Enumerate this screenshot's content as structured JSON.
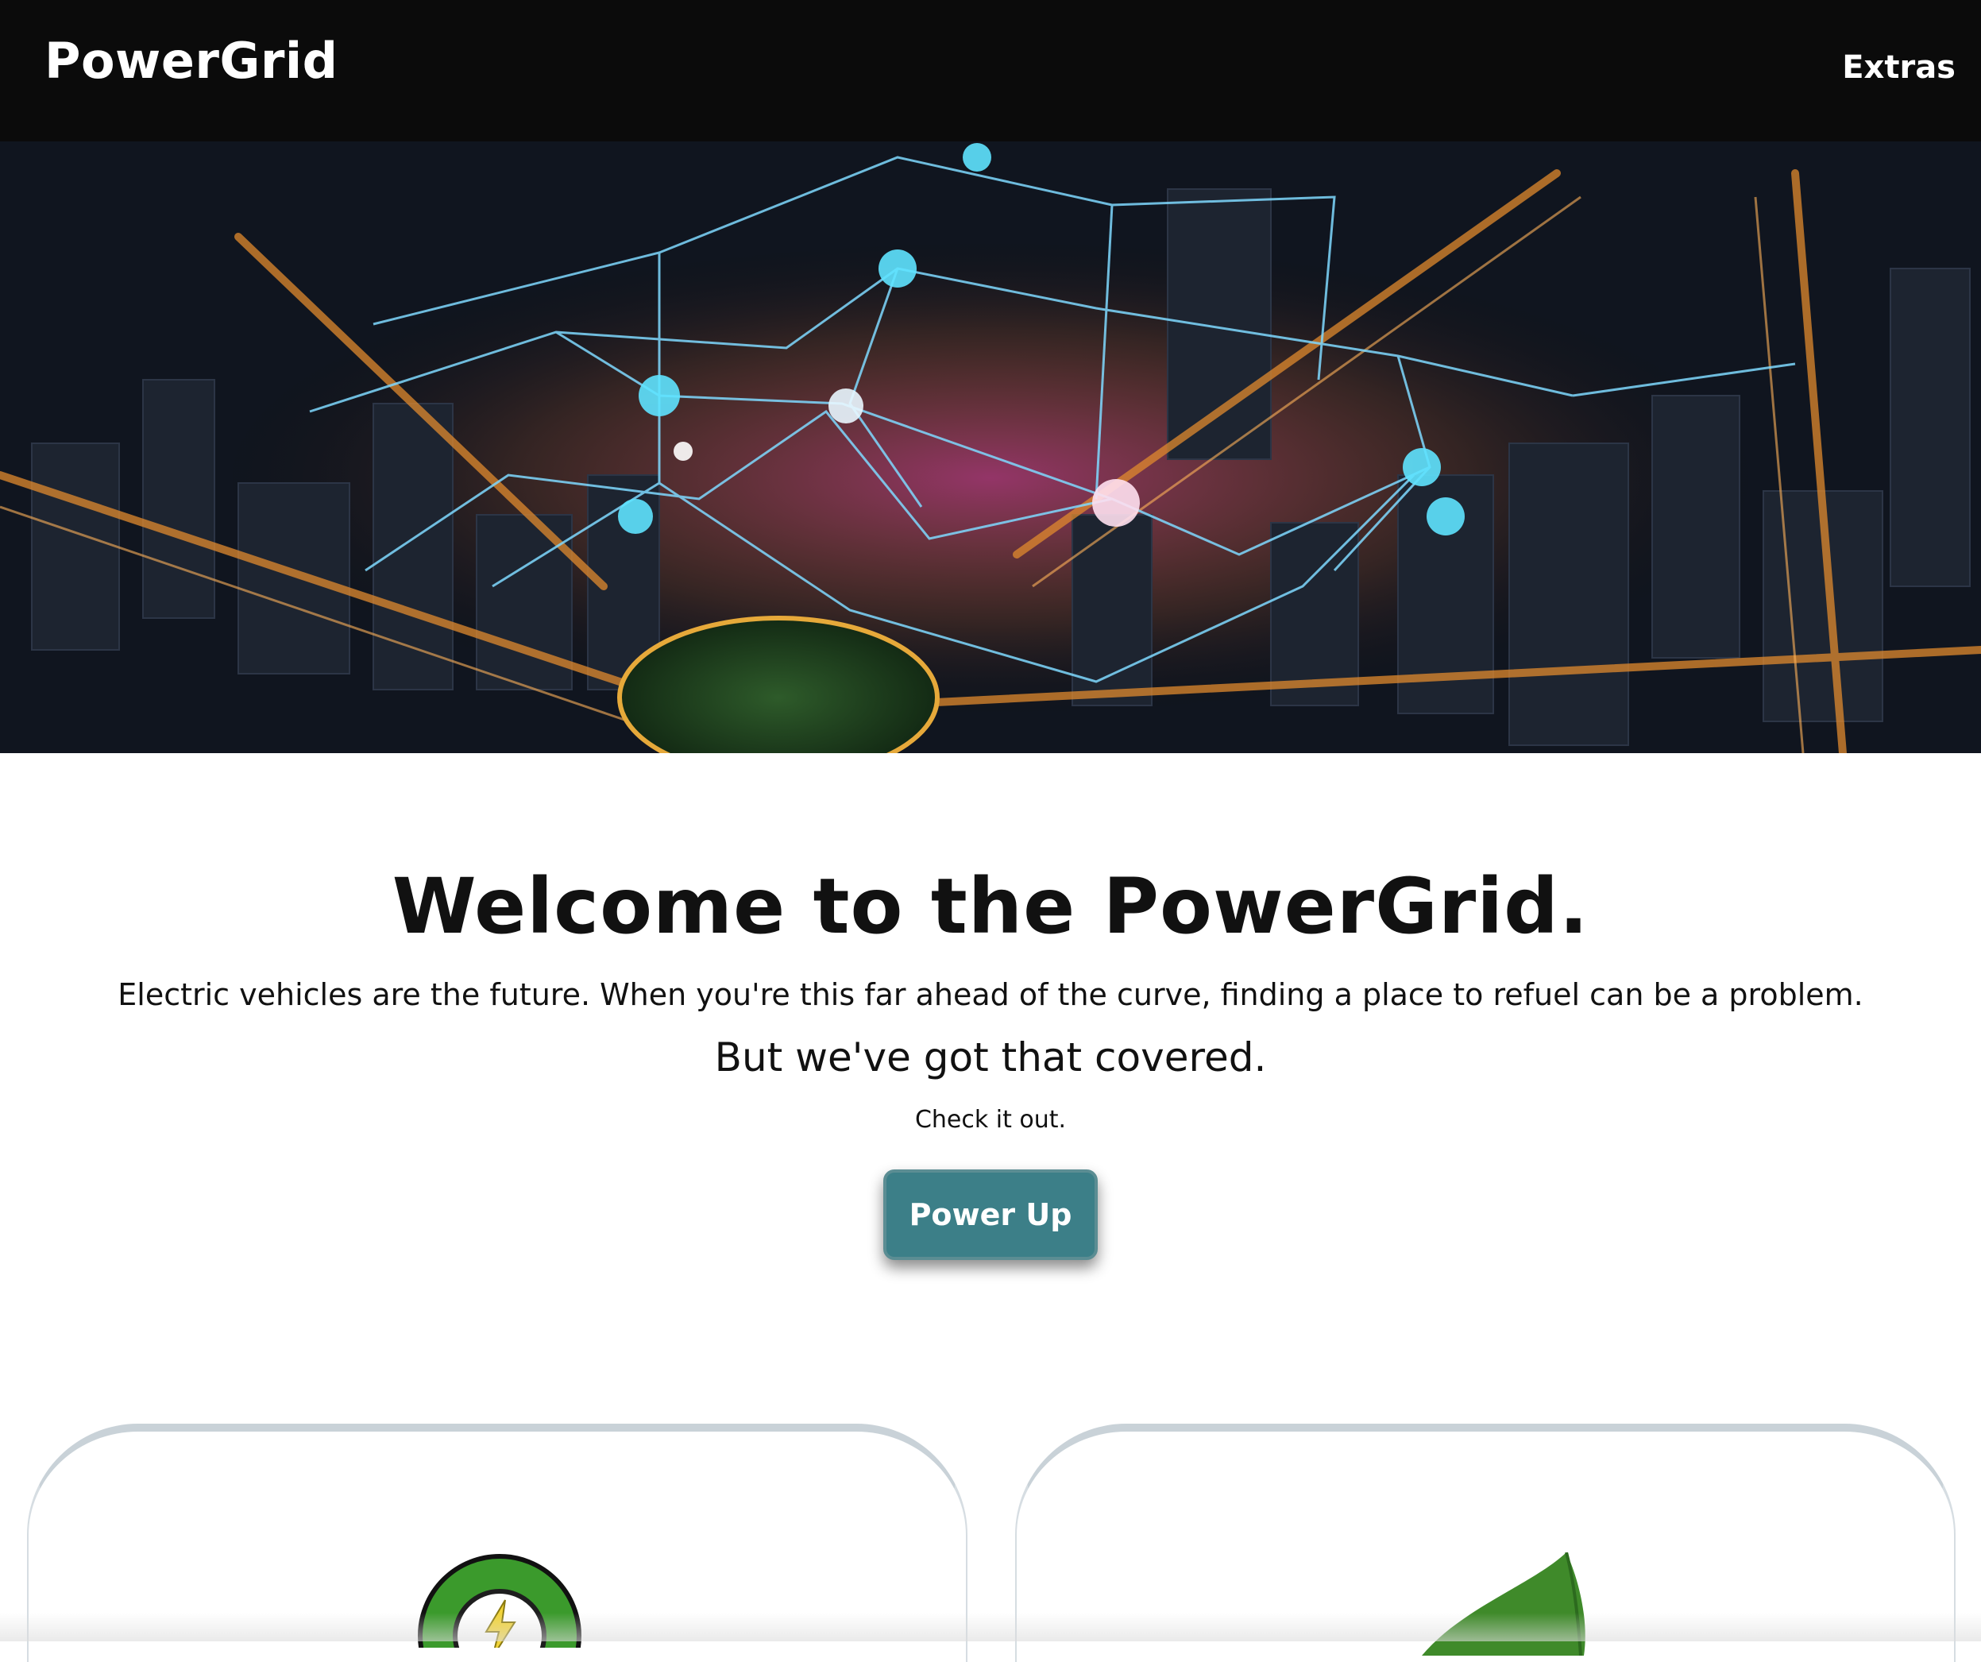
{
  "navbar": {
    "brand": "PowerGrid",
    "extras_label": "Extras"
  },
  "hero": {
    "image_alt": "aerial night city with glowing power network"
  },
  "intro": {
    "title": "Welcome to the PowerGrid.",
    "lead": "Electric vehicles are the future. When you're this far ahead of the curve, finding a place to refuel can be a problem.",
    "covered": "But we've got that covered.",
    "check": "Check it out.",
    "cta_label": "Power Up"
  },
  "cards": [
    {
      "icon": "charging-bolt-icon"
    },
    {
      "icon": "leaf-icon"
    }
  ],
  "colors": {
    "navbar_bg": "#0b0b0b",
    "cta_bg": "#3c7f88",
    "card_border": "#c9d2d8"
  }
}
